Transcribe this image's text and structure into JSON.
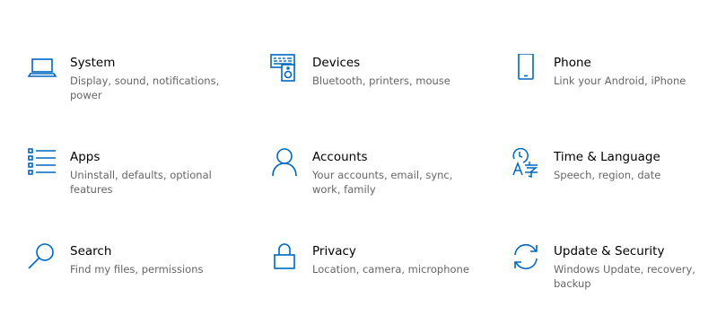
{
  "accent_color": "#0067c0",
  "tiles": [
    {
      "title": "System",
      "desc": "Display, sound, notifications, power",
      "icon": "laptop-icon"
    },
    {
      "title": "Devices",
      "desc": "Bluetooth, printers, mouse",
      "icon": "keyboard-speaker-icon"
    },
    {
      "title": "Phone",
      "desc": "Link your Android, iPhone",
      "icon": "phone-icon"
    },
    {
      "title": "Apps",
      "desc": "Uninstall, defaults, optional features",
      "icon": "apps-list-icon"
    },
    {
      "title": "Accounts",
      "desc": "Your accounts, email, sync, work, family",
      "icon": "person-icon"
    },
    {
      "title": "Time & Language",
      "desc": "Speech, region, date",
      "icon": "time-language-icon"
    },
    {
      "title": "Search",
      "desc": "Find my files, permissions",
      "icon": "search-icon"
    },
    {
      "title": "Privacy",
      "desc": "Location, camera, microphone",
      "icon": "lock-icon"
    },
    {
      "title": "Update & Security",
      "desc": "Windows Update, recovery, backup",
      "icon": "sync-icon"
    }
  ]
}
